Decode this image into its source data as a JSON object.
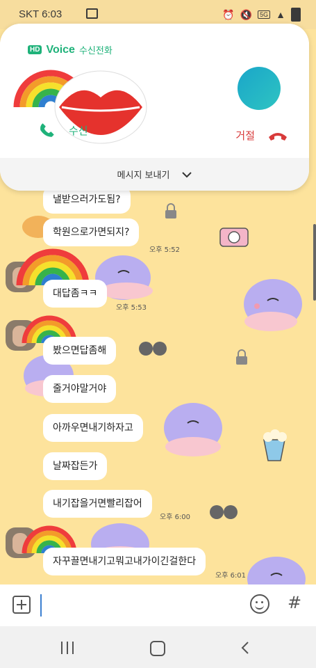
{
  "status_bar": {
    "carrier": "SKT 6:03",
    "network": "5G"
  },
  "call": {
    "hd_label": "HD",
    "voice_label": "Voice",
    "incoming_label": "수신전화",
    "accept_label": "수신",
    "reject_label": "거절",
    "send_message_label": "메시지 보내기"
  },
  "messages": [
    {
      "text": "낼받으러가도됨?"
    },
    {
      "text": "학원으로가면되지?"
    },
    {
      "text": "대답좀ㅋㅋ"
    },
    {
      "text": "봤으면답좀해"
    },
    {
      "text": "줄거야말거야"
    },
    {
      "text": "아까우면내기하자고"
    },
    {
      "text": "날짜잡든가"
    },
    {
      "text": "내기잡을거면빨리잡어"
    },
    {
      "text": "자꾸끌면내기고뭐고내가이긴걸한다"
    }
  ],
  "times": [
    "오후 5:52",
    "오후 5:53",
    "오후 6:00",
    "오후 6:01"
  ],
  "input": {
    "placeholder": ""
  }
}
